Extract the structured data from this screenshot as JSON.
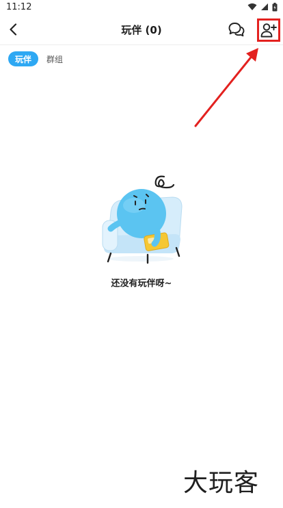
{
  "status_bar": {
    "time": "11:12",
    "icons": [
      "wifi-icon",
      "signal-icon",
      "battery-icon"
    ]
  },
  "header": {
    "title": "玩伴 (0)",
    "icons": [
      "back-arrow-icon",
      "chat-bubbles-icon",
      "add-friend-icon"
    ]
  },
  "tabs": [
    {
      "label": "玩伴",
      "active": true
    },
    {
      "label": "群组",
      "active": false
    }
  ],
  "empty_state": {
    "message": "还没有玩伴呀~"
  },
  "watermark": {
    "text": "大玩客"
  },
  "colors": {
    "accent": "#2ea8f3",
    "annotation": "#e3211f",
    "character": "#5bc4f1",
    "sofa": "#cfe9f8",
    "phone": "#f5c733"
  }
}
